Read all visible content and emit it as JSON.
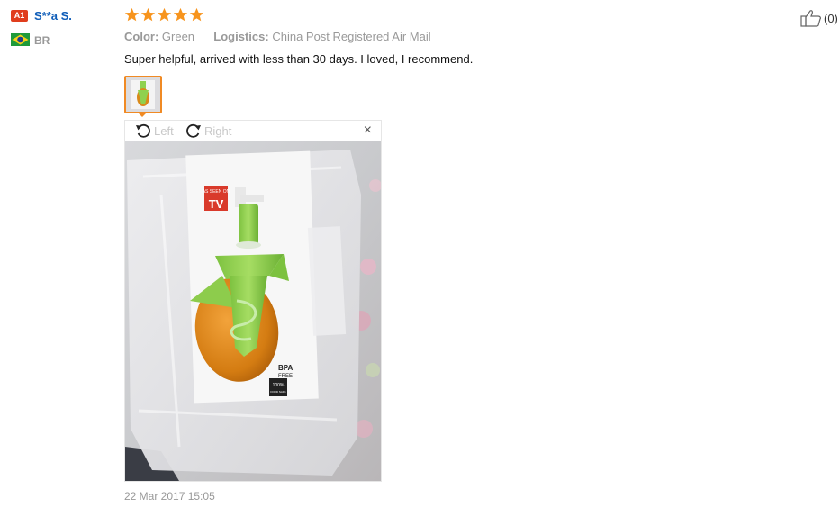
{
  "reviewer": {
    "level_badge": "A1",
    "name": "S**a S.",
    "country_code": "BR",
    "flag_icon": "brazil-flag-icon"
  },
  "review": {
    "rating": 5,
    "rating_max": 5,
    "star_color": "#f7941d",
    "color_label": "Color:",
    "color_value": "Green",
    "logistics_label": "Logistics:",
    "logistics_value": "China Post Registered Air Mail",
    "text": "Super helpful, arrived with less than 30 days. I loved, I recommend.",
    "date": "22 Mar 2017 15:05"
  },
  "viewer": {
    "rotate_left_label": "Left",
    "rotate_right_label": "Right",
    "close_label": "×",
    "photo_text": {
      "brand_line": "AS SEEN ON",
      "brand_big": "TV",
      "bpa_top": "BPA",
      "bpa_bottom": "FREE",
      "badge_top": "100%",
      "badge_bottom": "FOOD SAFE"
    }
  },
  "helpful": {
    "icon": "thumbs-up-icon",
    "count": "(0)"
  },
  "colors": {
    "accent": "#f08a24",
    "link": "#0f5db8",
    "badge": "#e03d1d",
    "muted": "#999999"
  }
}
